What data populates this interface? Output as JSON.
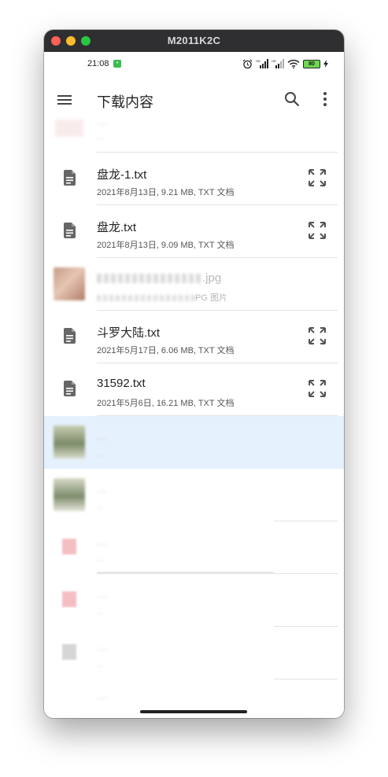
{
  "window": {
    "title": "M2011K2C"
  },
  "statusbar": {
    "time": "21:08",
    "battery": "80"
  },
  "appbar": {
    "title": "下载内容"
  },
  "files": [
    {
      "name": "...",
      "meta": "..."
    },
    {
      "name": "盘龙-1.txt",
      "meta": "2021年8月13日, 9.21 MB, TXT 文档"
    },
    {
      "name": "盘龙.txt",
      "meta": "2021年8月13日, 9.09 MB, TXT 文档"
    },
    {
      "name": ".jpg",
      "meta": "PG 图片"
    },
    {
      "name": "斗罗大陆.txt",
      "meta": "2021年5月17日, 6.06 MB, TXT 文档"
    },
    {
      "name": "31592.txt",
      "meta": "2021年5月6日, 16.21 MB, TXT 文档"
    },
    {
      "name": "...",
      "meta": "..."
    },
    {
      "name": "...",
      "meta": "..."
    },
    {
      "name": "...",
      "meta": "..."
    },
    {
      "name": "...",
      "meta": "..."
    },
    {
      "name": "...",
      "meta": "..."
    },
    {
      "name": "...",
      "meta": ""
    }
  ],
  "icons": {
    "menu": "menu-icon",
    "search": "search-icon",
    "more": "more-vert-icon",
    "document": "document-icon",
    "expand": "expand-icon"
  },
  "colors": {
    "selected_row": "#e5f1fc",
    "text_primary": "#222222",
    "text_secondary": "#555555",
    "titlebar": "#2f2f31"
  }
}
